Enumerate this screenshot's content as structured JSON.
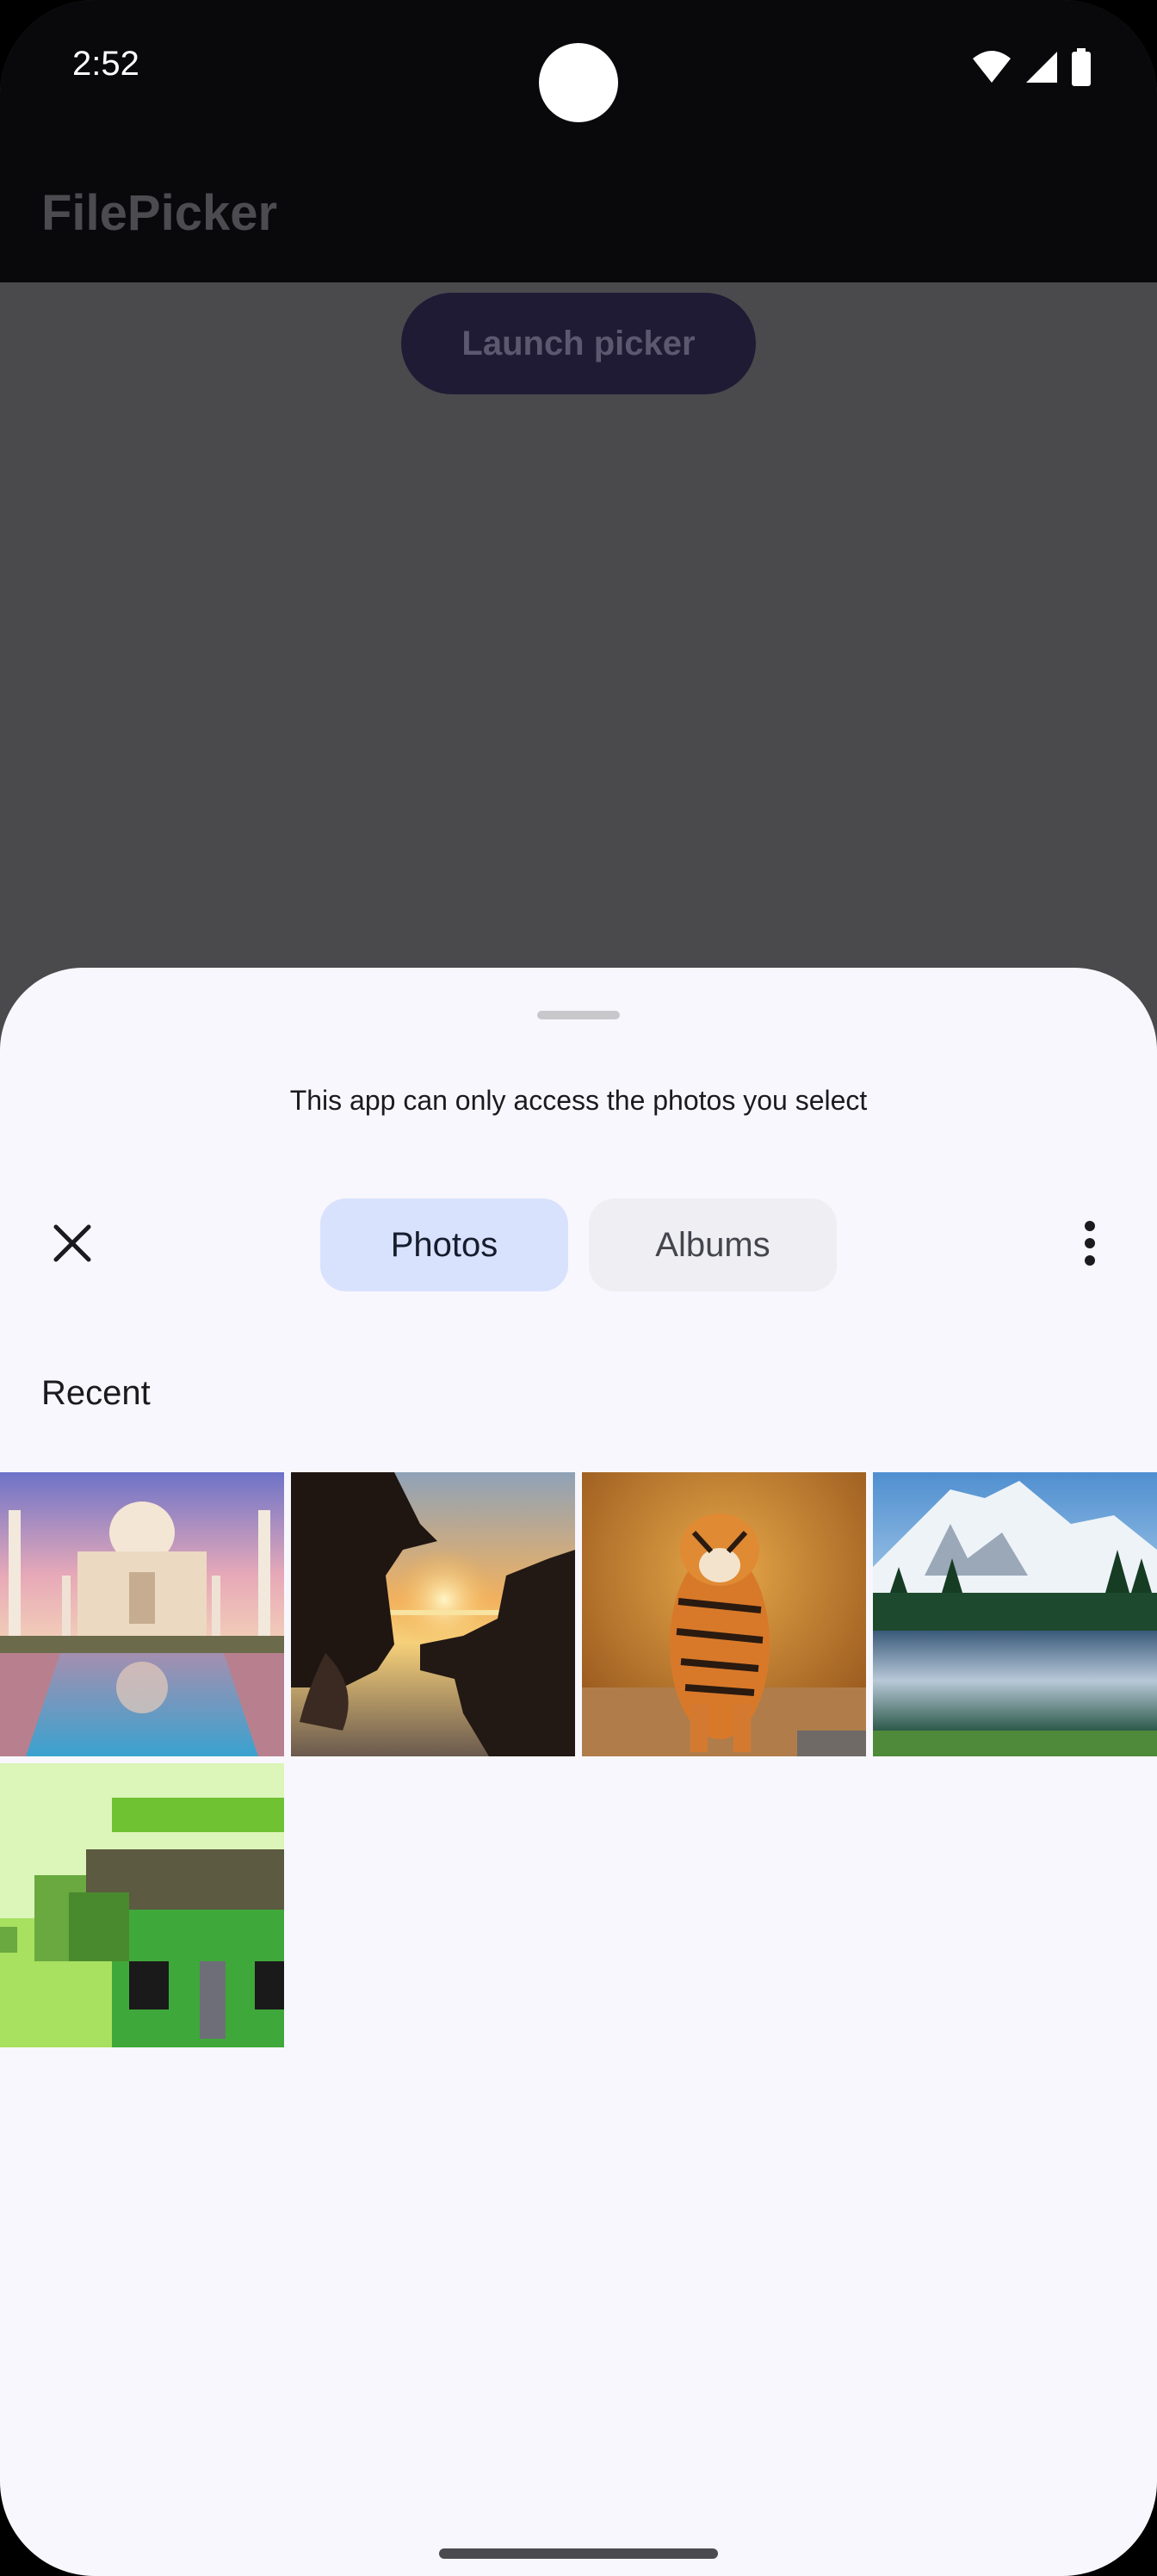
{
  "status_bar": {
    "time": "2:52"
  },
  "app": {
    "title": "FilePicker",
    "launch_button": "Launch picker"
  },
  "picker": {
    "notice": "This app can only access the photos you select",
    "tabs": [
      {
        "label": "Photos",
        "selected": true
      },
      {
        "label": "Albums",
        "selected": false
      }
    ],
    "section_title": "Recent",
    "photos": [
      {
        "subject": "taj-mahal"
      },
      {
        "subject": "sunset-hands-frame"
      },
      {
        "subject": "tiger"
      },
      {
        "subject": "mountain-lake"
      },
      {
        "subject": "pixel-art-house"
      }
    ]
  },
  "colors": {
    "selected_tab": "#d9e2fd",
    "unselected_tab": "#eeeef3",
    "sheet_background": "#f8f7fd",
    "scrim": "#4a4a4d"
  }
}
